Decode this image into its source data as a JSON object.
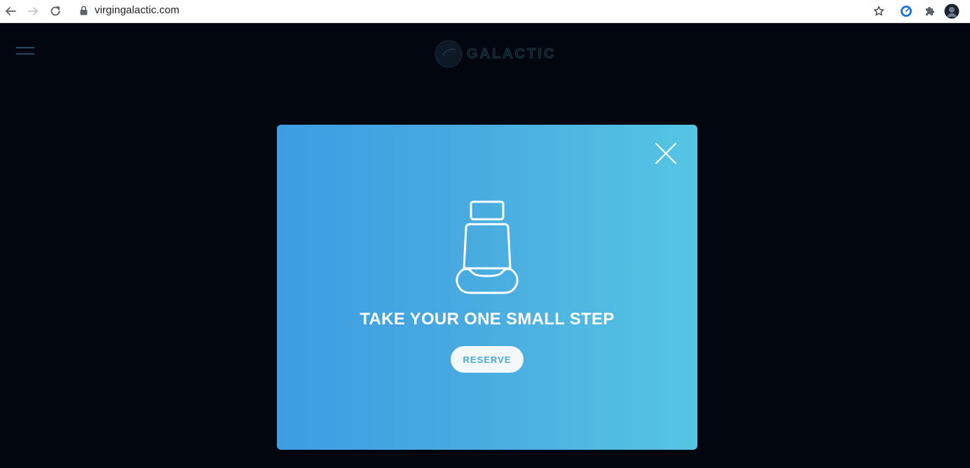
{
  "browser": {
    "url": "virgingalactic.com"
  },
  "site": {
    "logo_text": "GALACTIC"
  },
  "modal": {
    "title": "TAKE YOUR ONE SMALL STEP",
    "reserve_label": "RESERVE"
  },
  "colors": {
    "page_background": "#02070f",
    "modal_gradient_start": "#3d9de3",
    "modal_gradient_end": "#55c5e3",
    "button_text": "#48a9d6"
  },
  "icons": {
    "back": "arrow-left-icon",
    "forward": "arrow-right-icon",
    "reload": "reload-icon",
    "lock": "lock-icon",
    "bookmark": "star-icon",
    "extension_1": "speedometer-icon",
    "extensions": "puzzle-icon",
    "profile": "avatar",
    "menu": "hamburger-icon",
    "close": "close-icon",
    "seat": "seat-icon"
  }
}
